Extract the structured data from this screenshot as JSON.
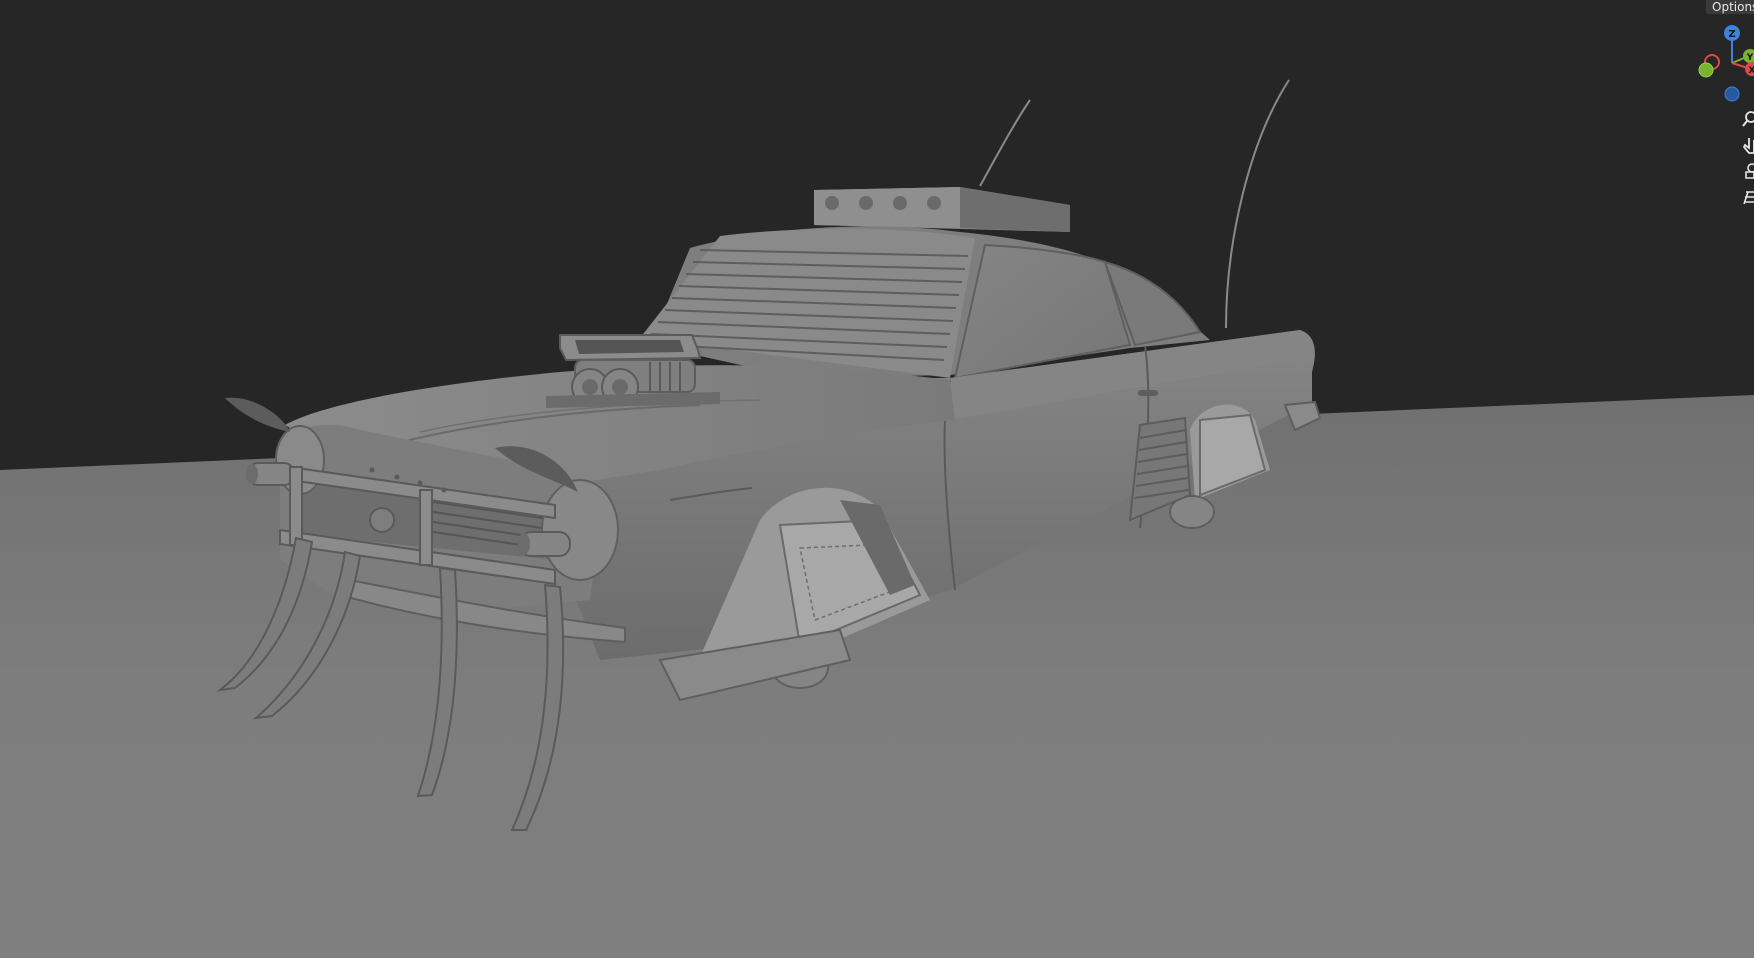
{
  "header": {
    "options_label": "Options"
  },
  "gizmo": {
    "z_label": "Z",
    "y_label": "Y",
    "x_label": "X"
  },
  "colors": {
    "background": "#262626",
    "floor": "#7a7a7a",
    "car_body": "#7b7b7b",
    "axis_x": "#e04848",
    "axis_y": "#78b42e",
    "axis_z": "#3c82e0"
  },
  "nav_tools": [
    {
      "name": "zoom-icon"
    },
    {
      "name": "pan-hand-icon"
    },
    {
      "name": "camera-icon"
    },
    {
      "name": "perspective-grid-icon"
    }
  ]
}
